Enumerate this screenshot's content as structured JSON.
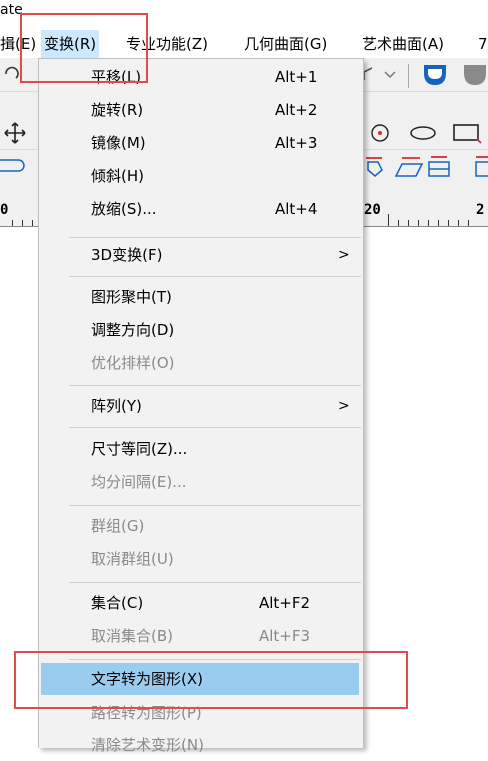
{
  "window": {
    "title_fragment": "ate"
  },
  "menubar": {
    "items": [
      {
        "label": "编辑(E)",
        "visible_text": "揖(E)"
      },
      {
        "label": "变换(R)"
      },
      {
        "label": "专业功能(Z)"
      },
      {
        "label": "几何曲面(G)"
      },
      {
        "label": "艺术曲面(A)"
      },
      {
        "label": "7"
      }
    ]
  },
  "ruler": {
    "left_label": "0",
    "mid_label": "20",
    "right_label": "2"
  },
  "transform_menu": {
    "groups": [
      [
        {
          "label": "平移(L)",
          "shortcut": "Alt+1",
          "enabled": true
        },
        {
          "label": "旋转(R)",
          "shortcut": "Alt+2",
          "enabled": true
        },
        {
          "label": "镜像(M)",
          "shortcut": "Alt+3",
          "enabled": true
        },
        {
          "label": "倾斜(H)",
          "shortcut": "",
          "enabled": true
        },
        {
          "label": "放缩(S)...",
          "shortcut": "Alt+4",
          "enabled": true
        }
      ],
      [
        {
          "label": "3D变换(F)",
          "submenu_indicator": ">",
          "enabled": true
        }
      ],
      [
        {
          "label": "图形聚中(T)",
          "enabled": true
        },
        {
          "label": "调整方向(D)",
          "enabled": true
        },
        {
          "label": "优化排样(O)",
          "enabled": false
        }
      ],
      [
        {
          "label": "阵列(Y)",
          "submenu_indicator": ">",
          "enabled": true
        }
      ],
      [
        {
          "label": "尺寸等同(Z)...",
          "enabled": true
        },
        {
          "label": "均分间隔(E)...",
          "enabled": false
        }
      ],
      [
        {
          "label": "群组(G)",
          "enabled": false
        },
        {
          "label": "取消群组(U)",
          "enabled": false
        }
      ],
      [
        {
          "label": "集合(C)",
          "shortcut": "Alt+F2",
          "enabled": true
        },
        {
          "label": "取消集合(B)",
          "shortcut": "Alt+F3",
          "enabled": false
        }
      ],
      [
        {
          "label": "文字转为图形(X)",
          "enabled": true,
          "highlighted": true
        },
        {
          "label": "路径转为图形(P)",
          "enabled": false
        },
        {
          "label": "清除艺术变形(N)",
          "enabled": false
        }
      ]
    ]
  },
  "colors": {
    "highlight": "#99ccee",
    "annotation": "#e04b4b",
    "menu_bg": "#f2f2f2",
    "icon_blue": "#1565c0",
    "icon_red": "#d32f2f"
  }
}
